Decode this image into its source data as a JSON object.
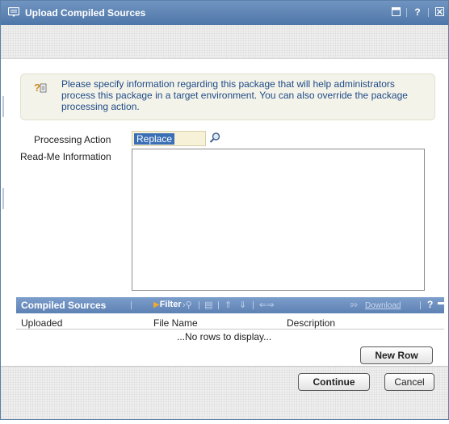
{
  "window": {
    "title": "Upload Compiled Sources",
    "controls": [
      "?"
    ]
  },
  "info": {
    "text": "Please specify information regarding this package that will help administrators process this package in a target environment. You can also override the package processing action."
  },
  "form": {
    "processing_action_label": "Processing Action",
    "processing_action_value": "Replace",
    "readme_label": "Read-Me Information",
    "readme_value": ""
  },
  "grid": {
    "title": "Compiled Sources",
    "filter_label": "Filter",
    "download_label": "Download",
    "help_label": "?",
    "columns": [
      "Uploaded",
      "File Name",
      "Description"
    ],
    "empty_text": "...No rows to display...",
    "new_row_label": "New Row"
  },
  "footer": {
    "continue_label": "Continue",
    "cancel_label": "Cancel"
  },
  "colors": {
    "titlebar": "#5b7fa8",
    "grid_header": "#6a8dbd",
    "info_text": "#1d4a87",
    "selection": "#3a6fb6"
  }
}
